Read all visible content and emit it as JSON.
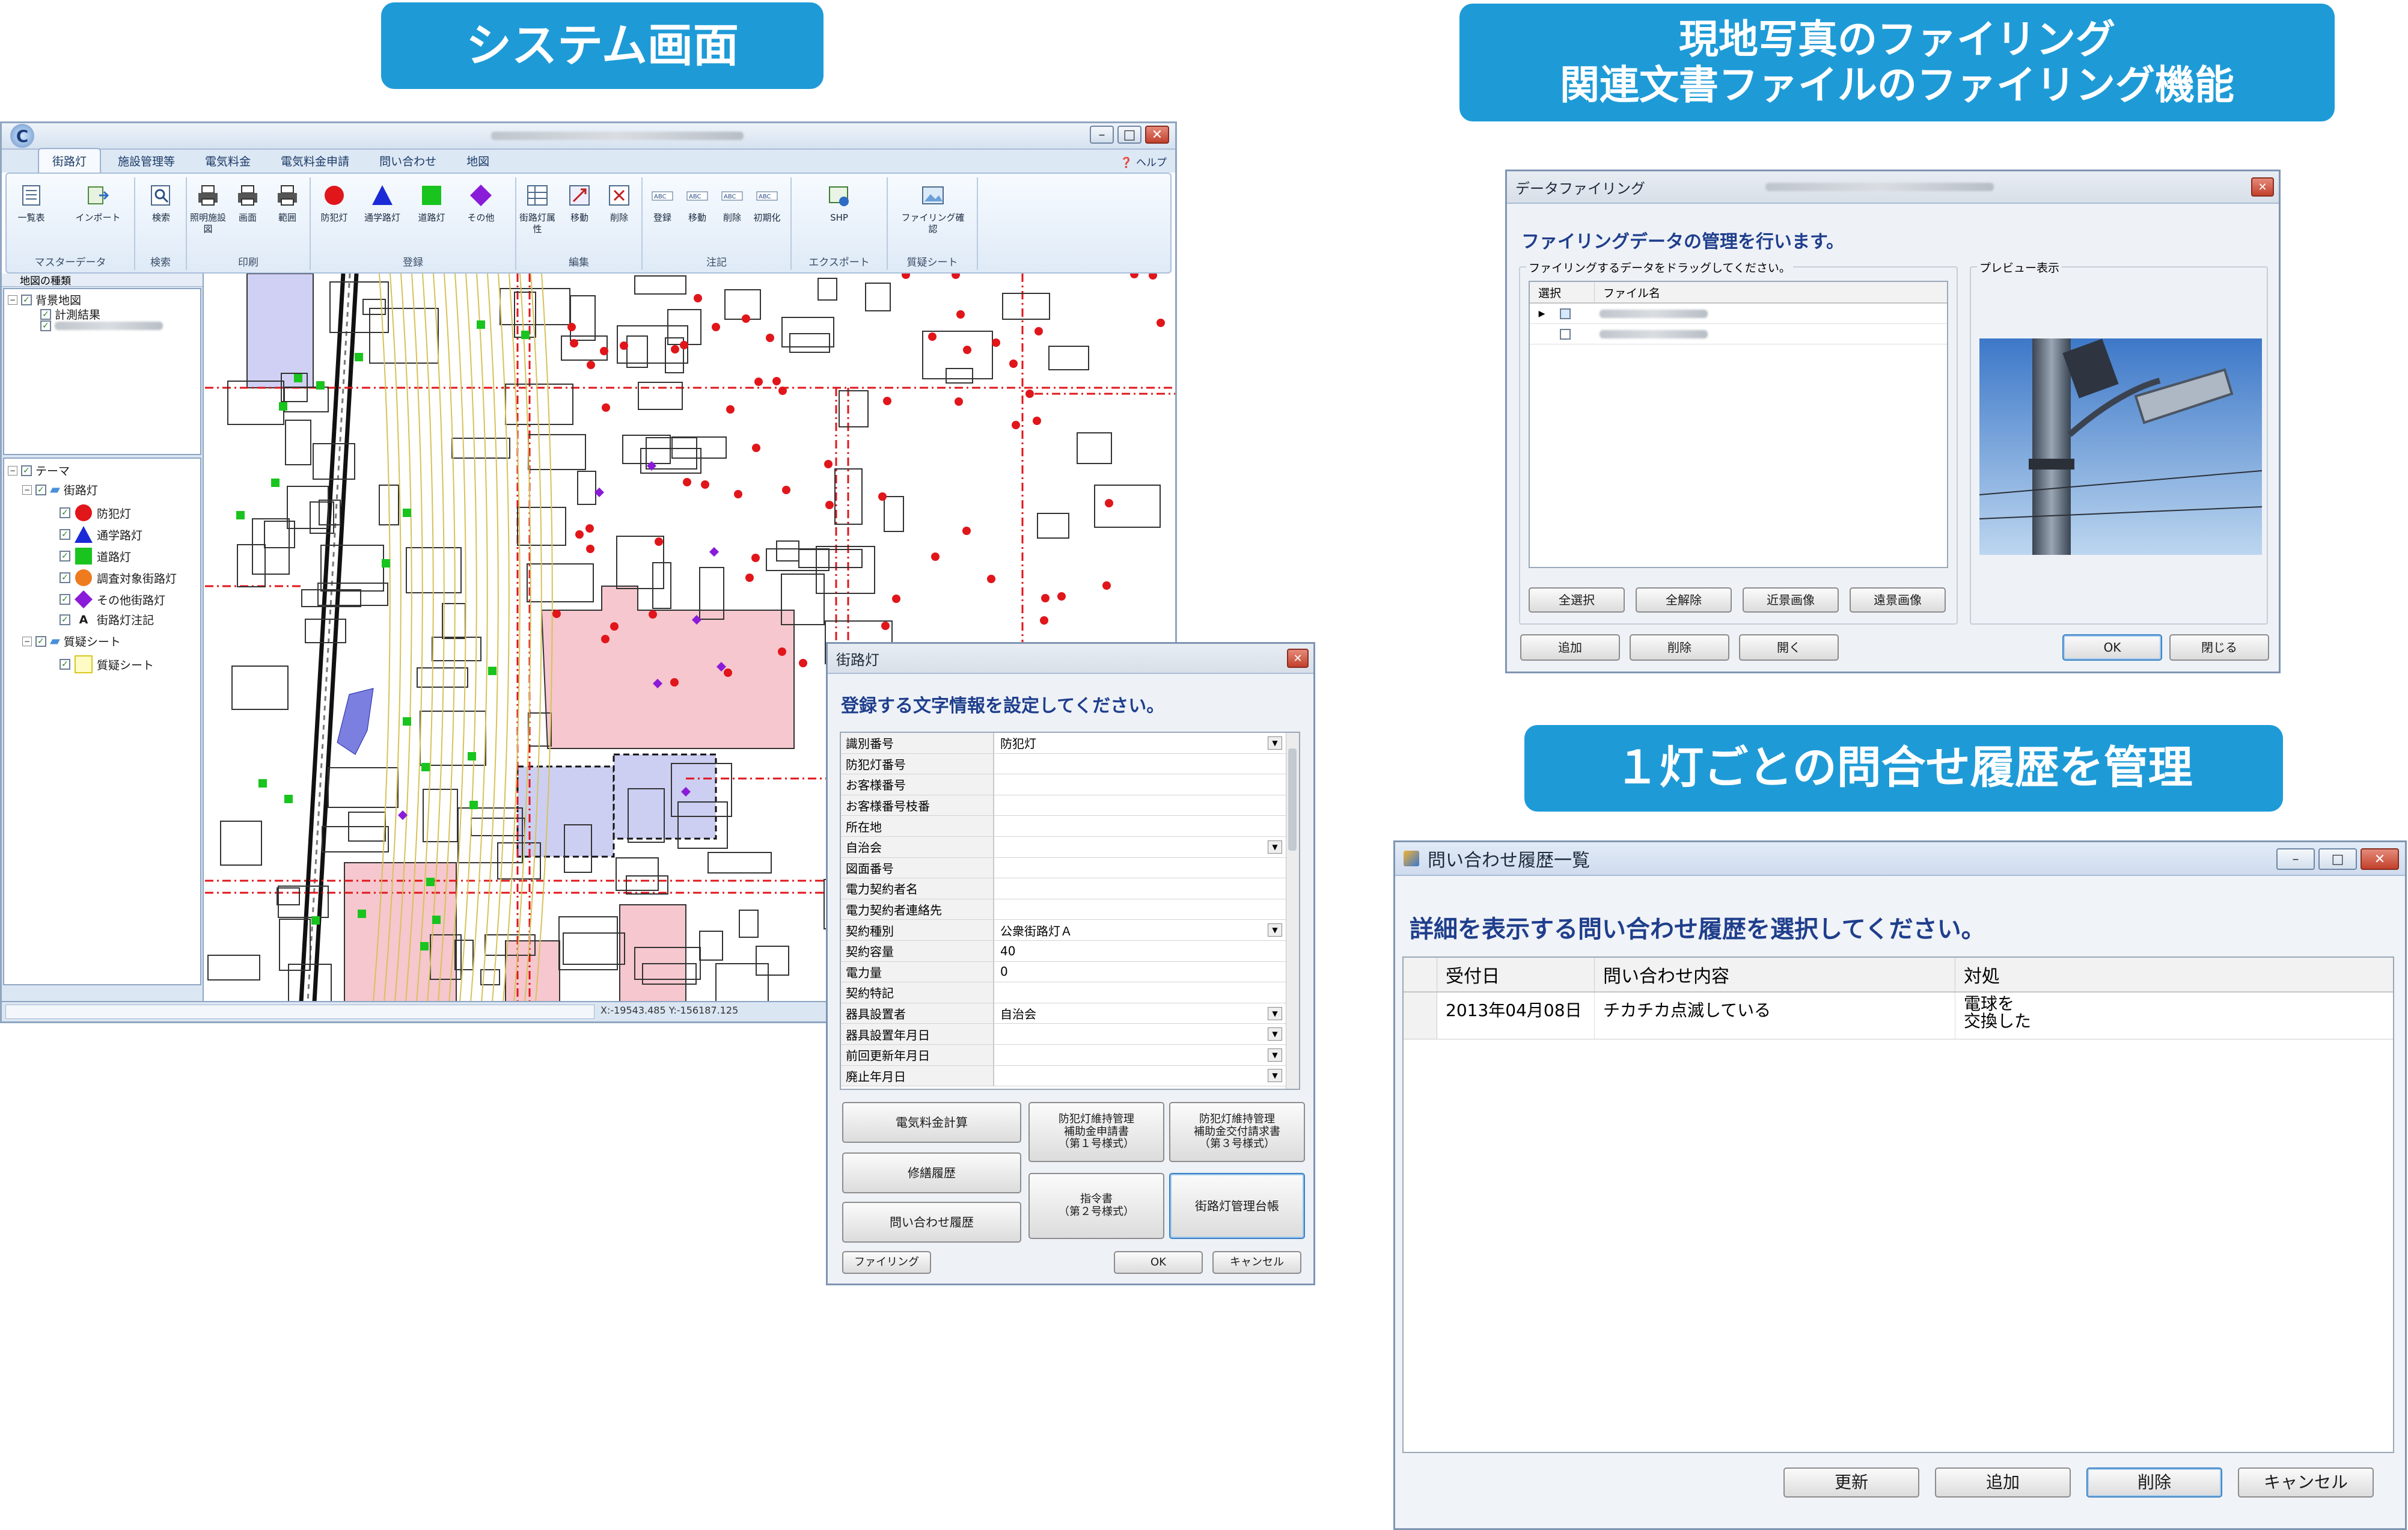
{
  "banners": {
    "system": "システム画面",
    "filing_line1": "現地写真のファイリング",
    "filing_line2": "関連文書ファイルのファイリング機能",
    "history": "１灯ごとの問合せ履歴を管理"
  },
  "main_window": {
    "tabs": [
      "街路灯",
      "施設管理等",
      "電気料金",
      "電気料金申請",
      "問い合わせ",
      "地図"
    ],
    "help": "ヘルプ",
    "groups": [
      {
        "label": "マスターデータ",
        "buttons": [
          "一覧表",
          "インポート"
        ]
      },
      {
        "label": "検索",
        "buttons": [
          "検索"
        ]
      },
      {
        "label": "印刷",
        "buttons": [
          "照明施設図",
          "画面",
          "範囲"
        ]
      },
      {
        "label": "登録",
        "buttons": [
          "防犯灯",
          "通学路灯",
          "道路灯",
          "その他"
        ]
      },
      {
        "label": "編集",
        "buttons": [
          "街路灯属性",
          "移動",
          "削除"
        ]
      },
      {
        "label": "注記",
        "buttons": [
          "登録",
          "移動",
          "削除",
          "初期化"
        ]
      },
      {
        "label": "エクスポート",
        "buttons": [
          "SHP"
        ]
      },
      {
        "label": "質疑シート",
        "buttons": [
          "ファイリング確認"
        ]
      }
    ],
    "layer_panel_title": "地図の種類",
    "background_tree": [
      "背景地図",
      "計測結果"
    ],
    "theme_tree": {
      "root": "テーマ",
      "group1": "街路灯",
      "items": [
        "防犯灯",
        "通学路灯",
        "道路灯",
        "調査対象街路灯",
        "その他街路灯",
        "街路灯注記"
      ],
      "group2": "質疑シート",
      "items2": [
        "質疑シート"
      ]
    },
    "status_coords": "X:-19543.485 Y:-156187.125",
    "colors": {
      "red": "#e0161b",
      "blue": "#1a2ad6",
      "green": "#19c41e",
      "orange": "#ee7b1e",
      "purple": "#8a1bd8",
      "yellow": "#f6ec1e"
    }
  },
  "streetlight_dialog": {
    "title": "街路灯",
    "prompt": "登録する文字情報を設定してください。",
    "fields": [
      {
        "label": "識別番号",
        "value": "防犯灯",
        "dropdown": true
      },
      {
        "label": "防犯灯番号",
        "value": "",
        "dropdown": false
      },
      {
        "label": "お客様番号",
        "value": "",
        "dropdown": false
      },
      {
        "label": "お客様番号枝番",
        "value": "",
        "dropdown": false
      },
      {
        "label": "所在地",
        "value": "",
        "dropdown": false
      },
      {
        "label": "自治会",
        "value": "",
        "dropdown": true
      },
      {
        "label": "図面番号",
        "value": "",
        "dropdown": false
      },
      {
        "label": "電力契約者名",
        "value": "",
        "dropdown": false
      },
      {
        "label": "電力契約者連絡先",
        "value": "",
        "dropdown": false
      },
      {
        "label": "契約種別",
        "value": "公衆街路灯Ａ",
        "dropdown": true
      },
      {
        "label": "契約容量",
        "value": "40",
        "dropdown": false
      },
      {
        "label": "電力量",
        "value": "0",
        "dropdown": false
      },
      {
        "label": "契約特記",
        "value": "",
        "dropdown": false
      },
      {
        "label": "器具設置者",
        "value": "自治会",
        "dropdown": true
      },
      {
        "label": "器具設置年月日",
        "value": "",
        "dropdown": true
      },
      {
        "label": "前回更新年月日",
        "value": "",
        "dropdown": true
      },
      {
        "label": "廃止年月日",
        "value": "",
        "dropdown": true
      }
    ],
    "buttons": {
      "electric_fee": "電気料金計算",
      "subsidy1": "防犯灯維持管理\n補助金申請書\n（第１号様式）",
      "subsidy3": "防犯灯維持管理\n補助金交付請求書\n（第３号様式）",
      "repair": "修繕履歴",
      "order": "指令書\n（第２号様式）",
      "inquiry": "問い合わせ履歴",
      "ledger": "街路灯管理台帳",
      "filing": "ファイリング",
      "ok": "OK",
      "cancel": "キャンセル"
    }
  },
  "filing_dialog": {
    "title": "データファイリング",
    "prompt": "ファイリングデータの管理を行います。",
    "list_caption": "ファイリングするデータをドラッグしてください。",
    "preview_caption": "プレビュー表示",
    "columns": [
      "選択",
      "ファイル名"
    ],
    "buttons": {
      "select_all": "全選択",
      "clear_all": "全解除",
      "near": "近景画像",
      "far": "遠景画像",
      "add": "追加",
      "delete": "削除",
      "open": "開く",
      "ok": "OK",
      "close": "閉じる"
    }
  },
  "history_window": {
    "title": "問い合わせ履歴一覧",
    "prompt": "詳細を表示する問い合わせ履歴を選択してください。",
    "columns": [
      "受付日",
      "問い合わせ内容",
      "対処"
    ],
    "rows": [
      {
        "date": "2013年04月08日",
        "content": "チカチカ点滅している",
        "action_line1": "電球を",
        "action_line2": "交換した"
      }
    ],
    "buttons": {
      "refresh": "更新",
      "add": "追加",
      "delete": "削除",
      "cancel": "キャンセル"
    }
  }
}
